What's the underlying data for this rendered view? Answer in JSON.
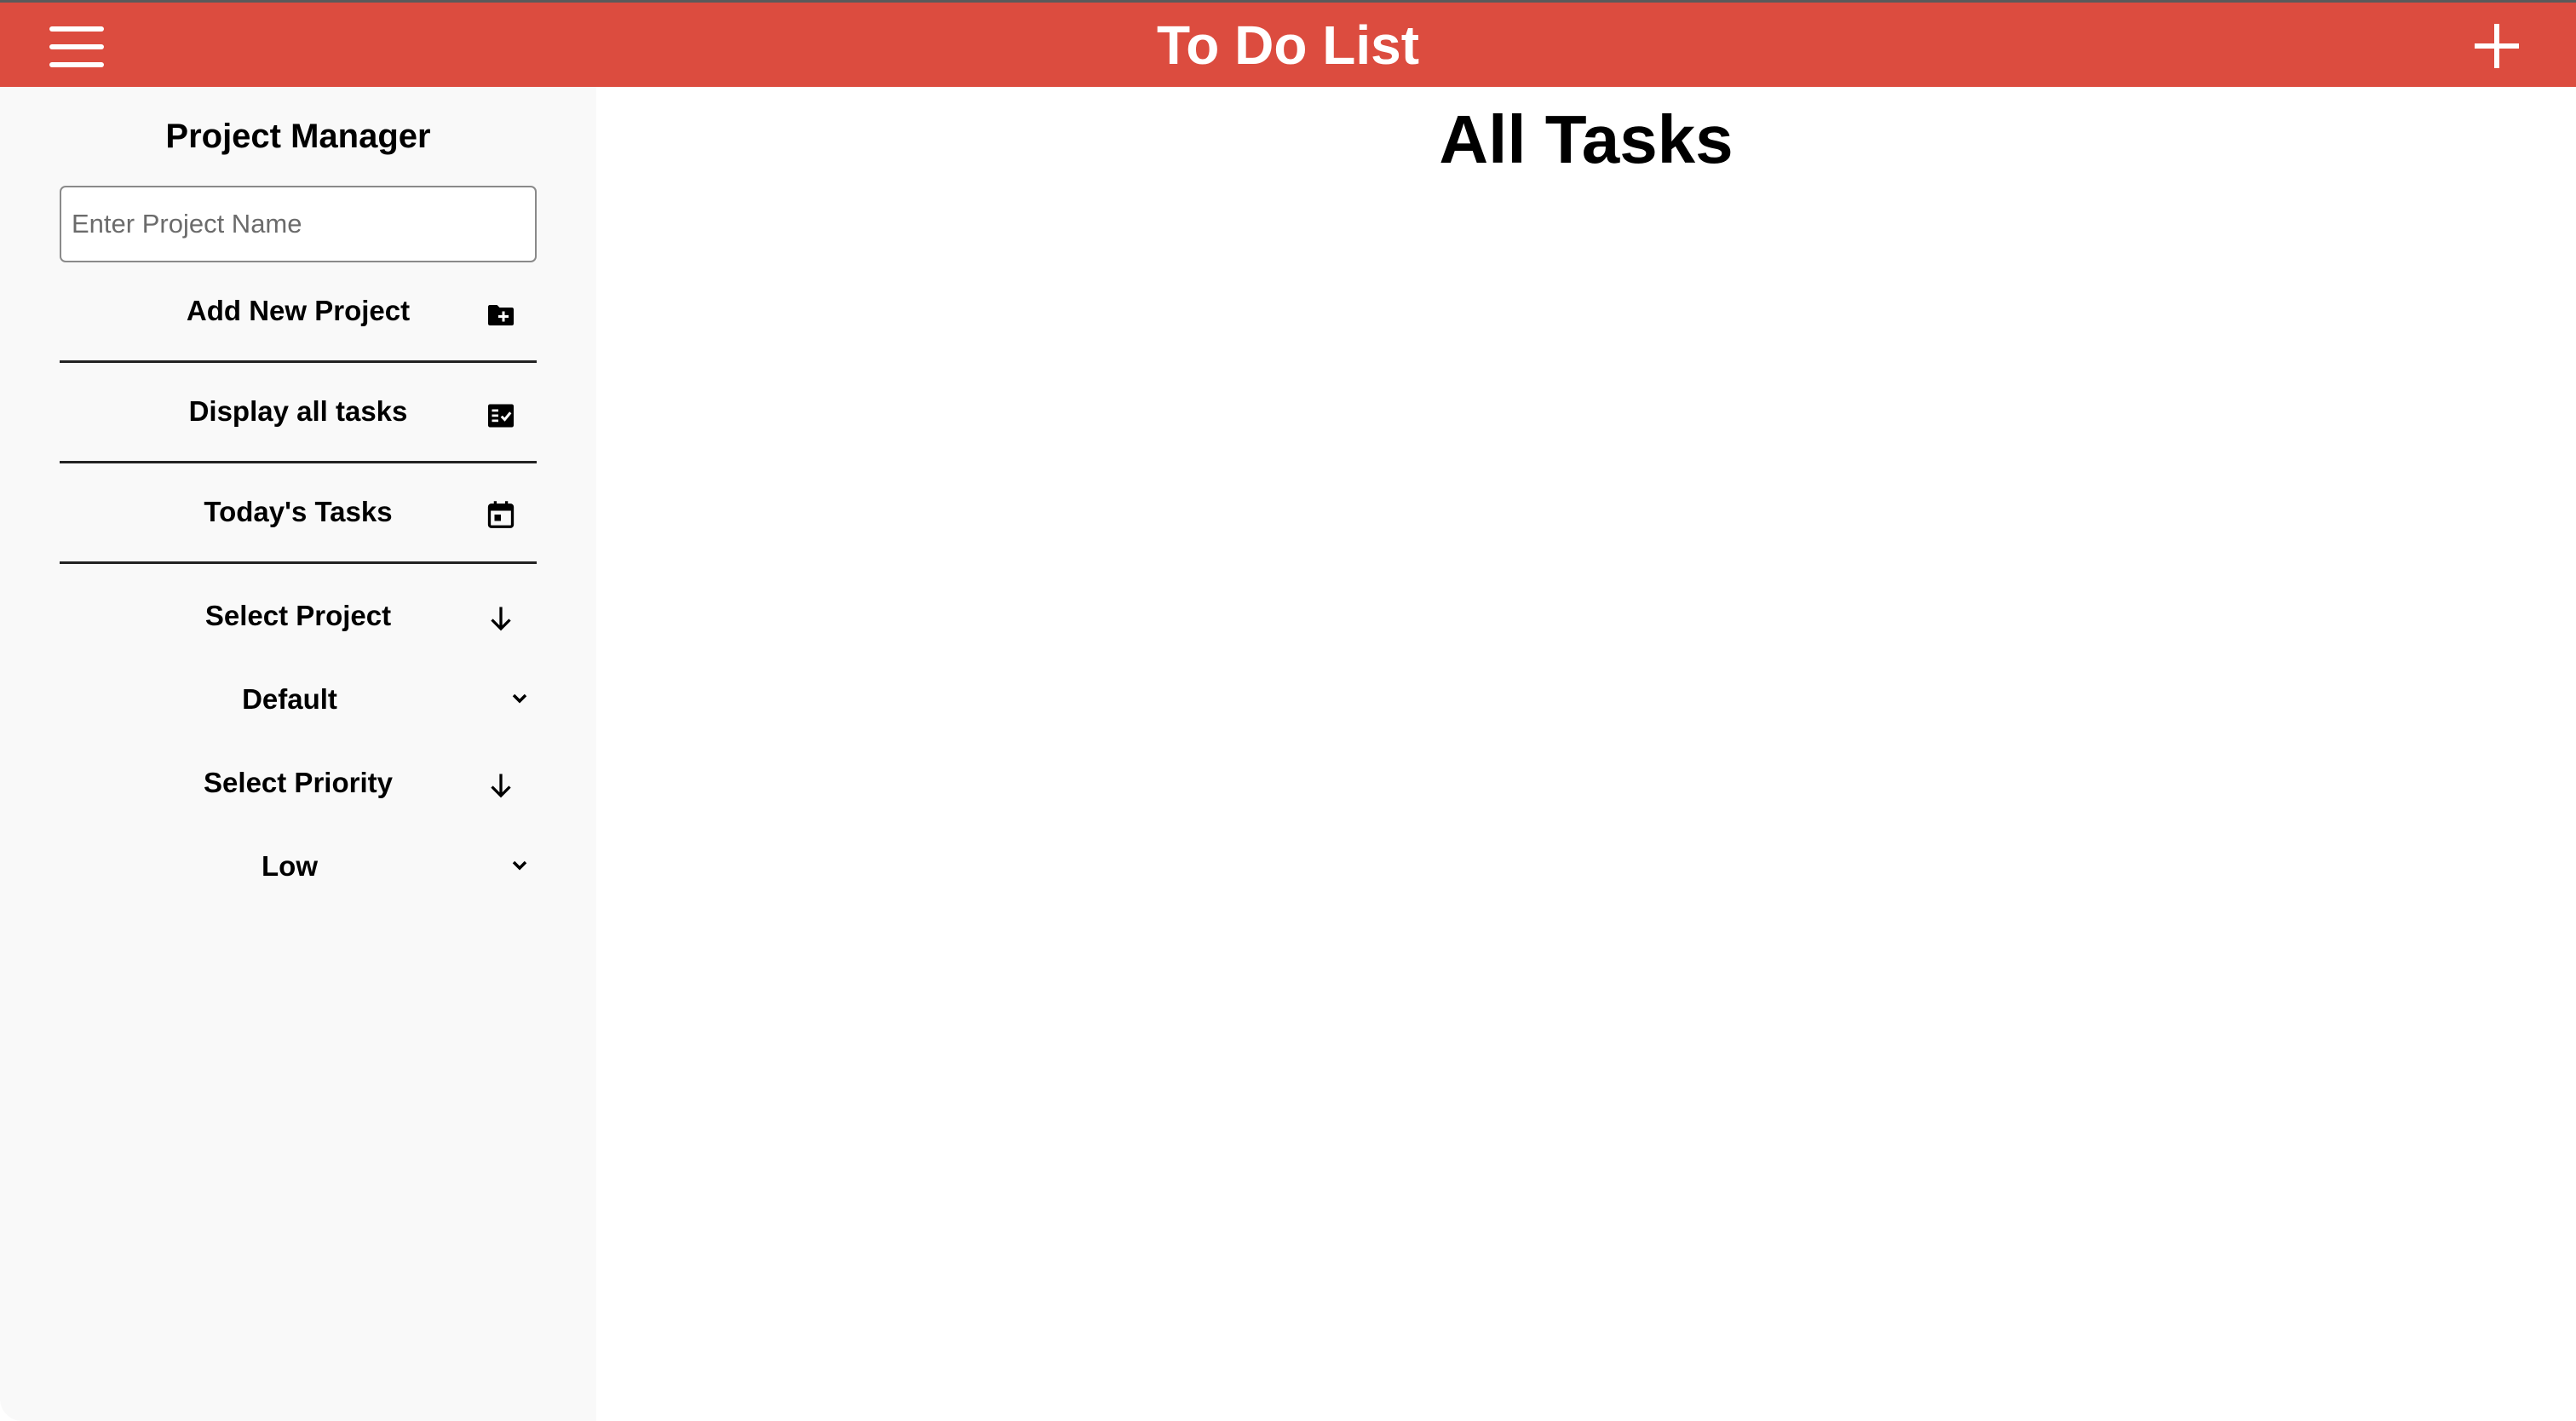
{
  "header": {
    "title": "To Do List",
    "menu_icon": "hamburger-menu-icon",
    "add_icon": "plus-icon",
    "background_color": "#dc4c3f"
  },
  "sidebar": {
    "title": "Project Manager",
    "project_input": {
      "placeholder": "Enter Project Name",
      "value": ""
    },
    "nav_items": [
      {
        "label": "Add New Project",
        "icon": "folder-add-icon"
      },
      {
        "label": "Display all tasks",
        "icon": "checklist-icon"
      },
      {
        "label": "Today's Tasks",
        "icon": "calendar-icon"
      }
    ],
    "project_select": {
      "label": "Select Project",
      "label_icon": "arrow-down-icon",
      "selected": "Default"
    },
    "priority_select": {
      "label": "Select Priority",
      "label_icon": "arrow-down-icon",
      "selected": "Low"
    }
  },
  "main": {
    "title": "All Tasks"
  }
}
